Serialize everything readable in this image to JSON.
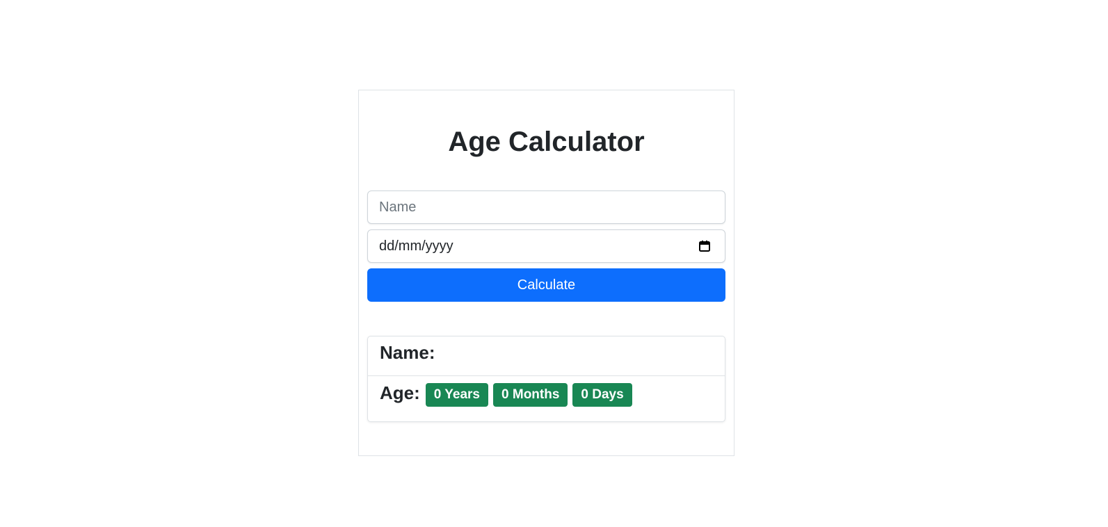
{
  "app": {
    "title": "Age Calculator"
  },
  "form": {
    "name_placeholder": "Name",
    "name_value": "",
    "date_placeholder": "dd/mm/yyyy",
    "date_icon": "calendar-icon",
    "calculate_label": "Calculate"
  },
  "result": {
    "name_label": "Name:",
    "name_value": "",
    "age_label": "Age:",
    "years": "0 Years",
    "months": "0 Months",
    "days": "0 Days"
  },
  "colors": {
    "primary": "#0d6efd",
    "success": "#198754",
    "text": "#212529",
    "border": "#dee2e6"
  }
}
